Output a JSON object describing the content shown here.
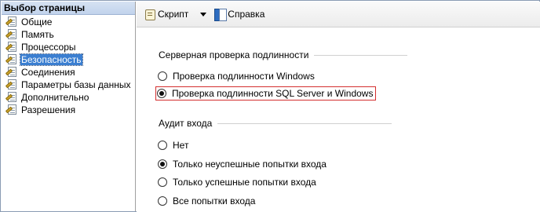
{
  "sidebar": {
    "header": "Выбор страницы",
    "items": [
      {
        "label": "Общие",
        "selected": false
      },
      {
        "label": "Память",
        "selected": false
      },
      {
        "label": "Процессоры",
        "selected": false
      },
      {
        "label": "Безопасность",
        "selected": true
      },
      {
        "label": "Соединения",
        "selected": false
      },
      {
        "label": "Параметры базы данных",
        "selected": false
      },
      {
        "label": "Дополнительно",
        "selected": false
      },
      {
        "label": "Разрешения",
        "selected": false
      }
    ]
  },
  "toolbar": {
    "script_label": "Скрипт",
    "help_label": "Справка"
  },
  "auth": {
    "title": "Серверная проверка подлинности",
    "options": [
      {
        "label": "Проверка подлинности Windows",
        "checked": false
      },
      {
        "label": "Проверка подлинности SQL Server и Windows",
        "checked": true
      }
    ]
  },
  "audit": {
    "title": "Аудит входа",
    "options": [
      {
        "label": "Нет",
        "checked": false
      },
      {
        "label": "Только неуспешные попытки входа",
        "checked": true
      },
      {
        "label": "Только успешные попытки входа",
        "checked": false
      },
      {
        "label": "Все попытки входа",
        "checked": false
      }
    ]
  },
  "colors": {
    "selection": "#3b7fd1",
    "highlight_border": "#d32f2f"
  }
}
